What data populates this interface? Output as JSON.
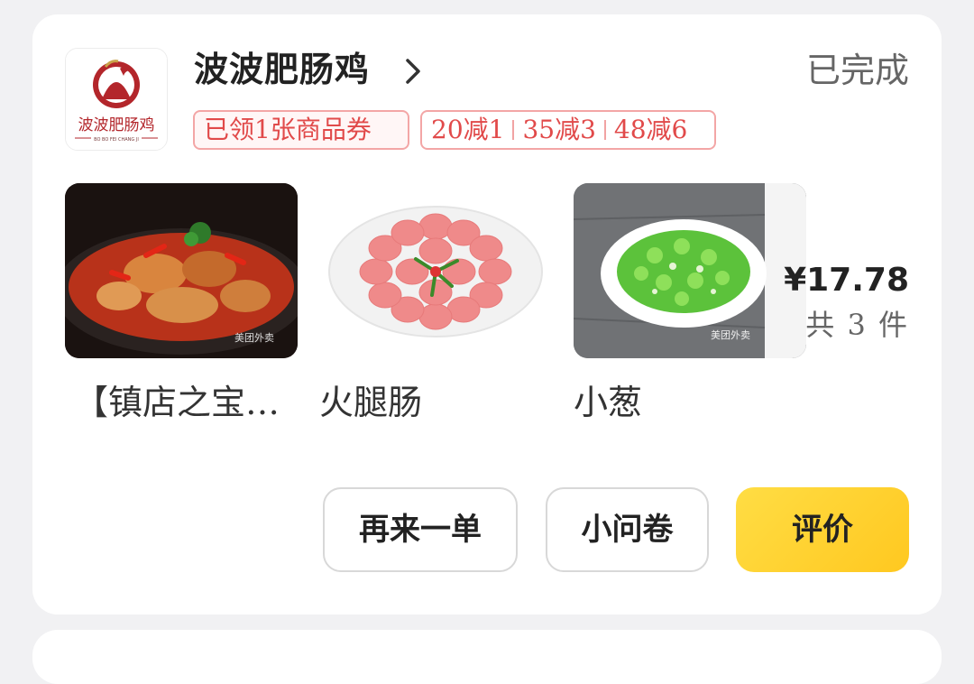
{
  "shop": {
    "name": "波波肥肠鸡",
    "logo_text": "波波肥肠鸡",
    "logo_subtext": "BO BO FEI CHANG JI",
    "status": "已完成"
  },
  "coupons": {
    "claimed": "已领1张商品券",
    "discounts": [
      "20减1",
      "35减3",
      "48减6"
    ]
  },
  "items": [
    {
      "name": "【镇店之宝…"
    },
    {
      "name": "火腿肠"
    },
    {
      "name": "小葱"
    }
  ],
  "watermark": "美团外卖",
  "summary": {
    "price": "¥17.78",
    "count": "共 3 件"
  },
  "actions": {
    "reorder": "再来一单",
    "survey": "小问卷",
    "review": "评价"
  },
  "colors": {
    "accent_red": "#e14a4a",
    "review_button": "#ffd52e",
    "logo_red": "#b3262b"
  }
}
